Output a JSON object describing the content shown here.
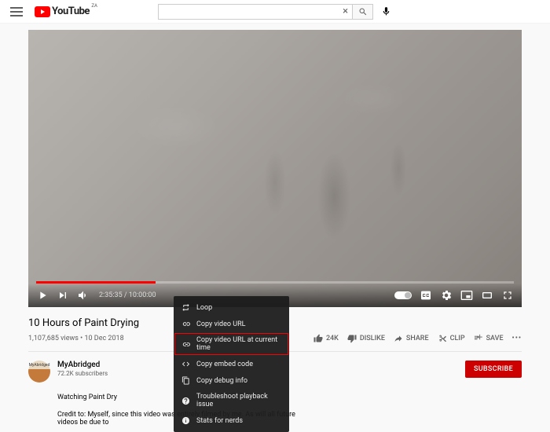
{
  "header": {
    "logo_text": "YouTube",
    "logo_badge": "ZA",
    "search_value": "",
    "search_clear": "×"
  },
  "player": {
    "current_time": "2:35:35",
    "duration": "10:00:00"
  },
  "video": {
    "title": "10 Hours of Paint Drying",
    "views": "1,107,685 views",
    "date": "10 Dec 2018"
  },
  "actions": {
    "like_count": "24K",
    "dislike": "DISLIKE",
    "share": "SHARE",
    "clip": "CLIP",
    "save": "SAVE"
  },
  "channel": {
    "name": "MyAbridged",
    "subs": "72.2K subscribers",
    "avatar_text": "MyAbridged",
    "subscribe": "SUBSCRIBE"
  },
  "description": {
    "heading": "Watching Paint Dry",
    "body": "Credit to: Myself, since this video was entirely filmed by me. As will all future videos be due to"
  },
  "context_menu": {
    "items": [
      "Loop",
      "Copy video URL",
      "Copy video URL at current time",
      "Copy embed code",
      "Copy debug info",
      "Troubleshoot playback issue",
      "Stats for nerds"
    ]
  }
}
